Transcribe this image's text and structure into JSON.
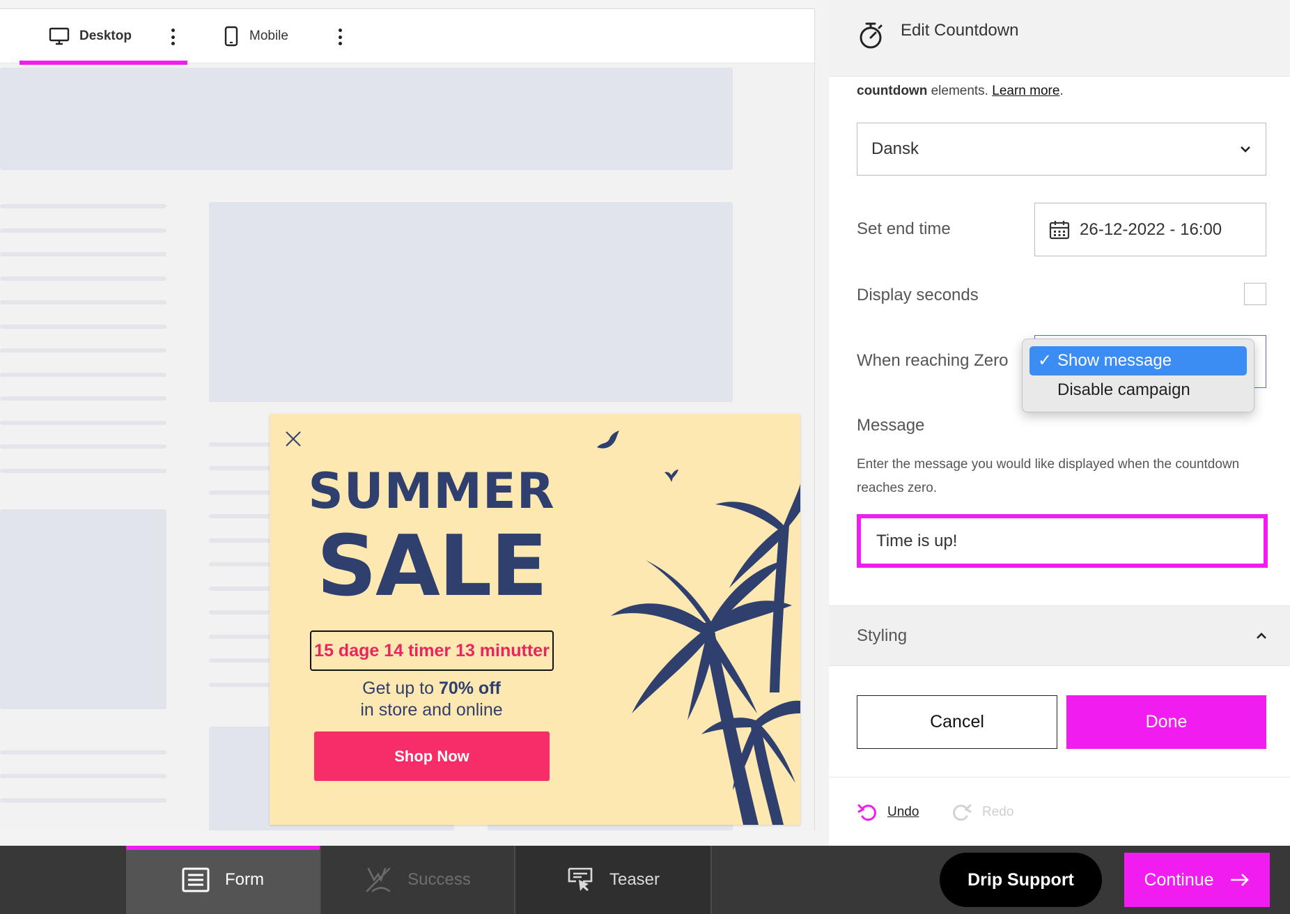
{
  "device_bar": {
    "desktop_label": "Desktop",
    "mobile_label": "Mobile"
  },
  "popup": {
    "headline_1": "SUMMER",
    "headline_2": "SALE",
    "countdown": "15 dage 14 timer 13 minutter",
    "offer_prefix": "Get up to ",
    "offer_bold": "70% off",
    "offer_line_2": "in store and online",
    "button_label": "Shop Now"
  },
  "panel": {
    "title": "Edit Countdown",
    "intro_bold": "countdown",
    "intro_text": " elements. ",
    "intro_link": "Learn more",
    "intro_end": ".",
    "language_value": "Dansk",
    "end_time_label": "Set end time",
    "end_time_value": "26-12-2022 - 16:00",
    "seconds_label": "Display seconds",
    "zero_label": "When reaching Zero",
    "zero_options": [
      "Show message",
      "Disable campaign"
    ],
    "zero_selected_check": "✓",
    "message_label": "Message",
    "message_help": "Enter the message you would like displayed when the countdown reaches zero.",
    "message_value": "Time is up!",
    "styling_label": "Styling",
    "cancel_label": "Cancel",
    "done_label": "Done",
    "undo_label": "Undo",
    "redo_label": "Redo"
  },
  "bottom_bar": {
    "form_label": "Form",
    "success_label": "Success",
    "teaser_label": "Teaser",
    "support_label": "Drip Support",
    "continue_label": "Continue"
  },
  "colors": {
    "accent": "#f01cf0",
    "popup_bg": "#fde8b1",
    "popup_navy": "#2f3f6e",
    "popup_pink": "#f72d68",
    "dropdown_selected": "#3b8cf3"
  },
  "icons": [
    "desktop-icon",
    "mobile-icon",
    "kebab-icon",
    "close-icon",
    "bird-icon",
    "palm-tree-icon",
    "stopwatch-icon",
    "chevron-down-icon",
    "calendar-icon",
    "checkmark-icon",
    "chevron-up-icon",
    "undo-icon",
    "redo-icon",
    "form-icon",
    "success-icon",
    "teaser-icon",
    "arrow-right-icon"
  ]
}
